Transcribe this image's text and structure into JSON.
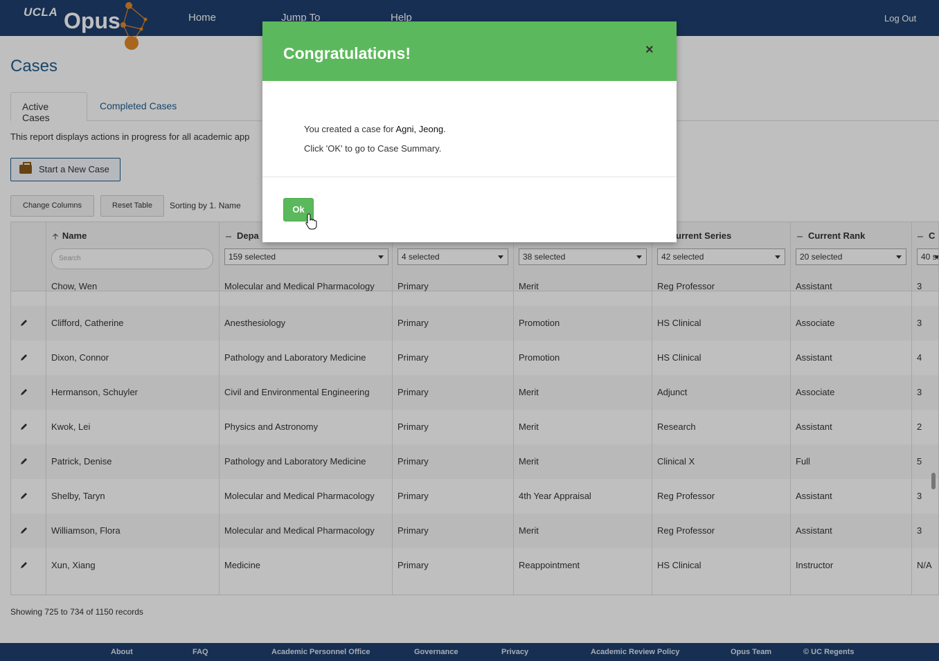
{
  "header": {
    "logo_ucla": "UCLA",
    "logo_opus": "Opus",
    "nav": [
      "Home",
      "Jump To",
      "Help"
    ],
    "logout": "Log Out"
  },
  "page": {
    "title": "Cases",
    "tabs": [
      "Active Cases",
      "Completed Cases"
    ],
    "description": "This report displays actions in progress for all academic app",
    "start_new_case": "Start a New Case",
    "change_columns": "Change Columns",
    "reset_table": "Reset Table",
    "sorting": "Sorting by 1. Name"
  },
  "table": {
    "headers": [
      "Name",
      "Depa",
      "",
      "",
      "urrent Series",
      "Current Rank",
      "C"
    ],
    "search_placeholder": "Search",
    "filters": [
      "159 selected",
      "4 selected",
      "38 selected",
      "42 selected",
      "20 selected",
      "40 se"
    ],
    "partial_row": [
      "Chow, Wen",
      "Molecular and Medical Pharmacology",
      "Primary",
      "Merit",
      "Reg Professor",
      "Assistant",
      "3"
    ],
    "rows": [
      [
        "Clifford, Catherine",
        "Anesthesiology",
        "Primary",
        "Promotion",
        "HS Clinical",
        "Associate",
        "3"
      ],
      [
        "Dixon, Connor",
        "Pathology and Laboratory Medicine",
        "Primary",
        "Promotion",
        "HS Clinical",
        "Assistant",
        "4"
      ],
      [
        "Hermanson, Schuyler",
        "Civil and Environmental Engineering",
        "Primary",
        "Merit",
        "Adjunct",
        "Associate",
        "3"
      ],
      [
        "Kwok, Lei",
        "Physics and Astronomy",
        "Primary",
        "Merit",
        "Research",
        "Assistant",
        "2"
      ],
      [
        "Patrick, Denise",
        "Pathology and Laboratory Medicine",
        "Primary",
        "Merit",
        "Clinical X",
        "Full",
        "5"
      ],
      [
        "Shelby, Taryn",
        "Molecular and Medical Pharmacology",
        "Primary",
        "4th Year Appraisal",
        "Reg Professor",
        "Assistant",
        "3"
      ],
      [
        "Williamson, Flora",
        "Molecular and Medical Pharmacology",
        "Primary",
        "Merit",
        "Reg Professor",
        "Assistant",
        "3"
      ],
      [
        "Xun, Xiang",
        "Medicine",
        "Primary",
        "Reappointment",
        "HS Clinical",
        "Instructor",
        "N/A"
      ]
    ],
    "records": "Showing 725 to 734 of 1150 records"
  },
  "footer": [
    "About",
    "FAQ",
    "Academic Personnel Office",
    "Governance",
    "Privacy",
    "Academic Review Policy",
    "Opus Team",
    "© UC Regents"
  ],
  "modal": {
    "title": "Congratulations!",
    "close": "×",
    "line1_prefix": "You created a case for ",
    "line1_name": "Agni, Jeong",
    "line1_suffix": ".",
    "line2": "Click 'OK' to go to Case Summary.",
    "ok": "Ok"
  },
  "colors": {
    "header_bg": "#1f3f6e",
    "modal_header": "#5cb85c",
    "accent": "#1f5d8f",
    "logo_orange": "#e0892a"
  }
}
